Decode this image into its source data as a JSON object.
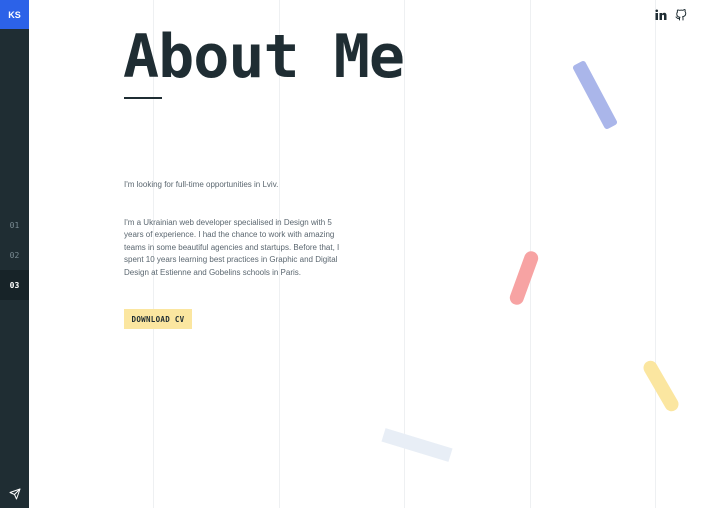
{
  "sidebar": {
    "logo": "KS",
    "items": [
      {
        "label": "01",
        "active": false
      },
      {
        "label": "02",
        "active": false
      },
      {
        "label": "03",
        "active": true
      }
    ],
    "send_icon": "send-icon"
  },
  "social": {
    "icons": [
      "linkedin-icon",
      "github-icon"
    ]
  },
  "main": {
    "title": "About Me",
    "intro": "I'm looking for full-time opportunities in Lviv.",
    "bio": "I'm a Ukrainian web developer specialised in Design with 5 years of experience. I had the chance to work with amazing teams in some beautiful agencies and startups. Before that, I spent 10 years learning best practices in Graphic and Digital Design at Estienne and Gobelins schools in Paris.",
    "cv_button": "DOWNLOAD CV"
  },
  "colors": {
    "sidebar": "#1f2d33",
    "logo_bg": "#2c62e8",
    "cv_button": "#fbe6a0",
    "shape_blue": "#aab6ea",
    "shape_red": "#f7a3a3",
    "shape_yellow": "#fbe6a0",
    "shape_light": "#e8eef6"
  }
}
